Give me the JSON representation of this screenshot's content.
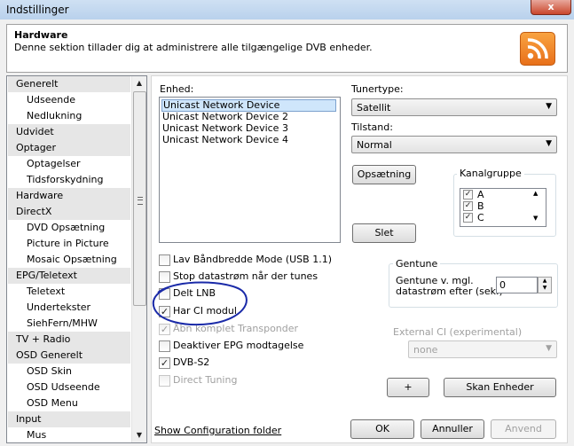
{
  "window": {
    "title": "Indstillinger",
    "close_label": "x"
  },
  "header": {
    "title": "Hardware",
    "description": "Denne sektion tillader dig at administrere alle tilgængelige DVB enheder."
  },
  "sidebar": {
    "items": [
      {
        "label": "Generelt",
        "level": 0
      },
      {
        "label": "Udseende",
        "level": 1
      },
      {
        "label": "Nedlukning",
        "level": 1
      },
      {
        "label": "Udvidet",
        "level": 0
      },
      {
        "label": "Optager",
        "level": 0
      },
      {
        "label": "Optagelser",
        "level": 1
      },
      {
        "label": "Tidsforskydning",
        "level": 1
      },
      {
        "label": "Hardware",
        "level": 0
      },
      {
        "label": "DirectX",
        "level": 0
      },
      {
        "label": "DVD Opsætning",
        "level": 1
      },
      {
        "label": "Picture in Picture",
        "level": 1
      },
      {
        "label": "Mosaic Opsætning",
        "level": 1
      },
      {
        "label": "EPG/Teletext",
        "level": 0
      },
      {
        "label": "Teletext",
        "level": 1
      },
      {
        "label": "Undertekster",
        "level": 1
      },
      {
        "label": "SiehFern/MHW",
        "level": 1
      },
      {
        "label": "TV + Radio",
        "level": 0
      },
      {
        "label": "OSD Generelt",
        "level": 0
      },
      {
        "label": "OSD Skin",
        "level": 1
      },
      {
        "label": "OSD Udseende",
        "level": 1
      },
      {
        "label": "OSD Menu",
        "level": 1
      },
      {
        "label": "Input",
        "level": 0
      },
      {
        "label": "Mus",
        "level": 1
      }
    ]
  },
  "device": {
    "label": "Enhed:",
    "items": [
      "Unicast Network Device",
      "Unicast Network Device 2",
      "Unicast Network Device 3",
      "Unicast Network Device 4"
    ],
    "selected_index": 0
  },
  "tuner": {
    "label": "Tunertype:",
    "value": "Satellit"
  },
  "state": {
    "label": "Tilstand:",
    "value": "Normal"
  },
  "buttons": {
    "setup": "Opsætning",
    "delete": "Slet",
    "plus": "+",
    "scan": "Skan Enheder",
    "ok": "OK",
    "cancel": "Annuller",
    "apply": "Anvend"
  },
  "channel_group": {
    "title": "Kanalgruppe",
    "items": [
      {
        "label": "A",
        "checked": true
      },
      {
        "label": "B",
        "checked": true
      },
      {
        "label": "C",
        "checked": true
      }
    ]
  },
  "options": [
    {
      "label": "Lav Båndbredde Mode (USB 1.1)",
      "checked": false,
      "enabled": true
    },
    {
      "label": "Stop datastrøm når der tunes",
      "checked": false,
      "enabled": true
    },
    {
      "label": "Delt LNB",
      "checked": false,
      "enabled": true
    },
    {
      "label": "Har CI modul",
      "checked": true,
      "enabled": true
    },
    {
      "label": "Åbn komplet Transponder",
      "checked": true,
      "enabled": false
    },
    {
      "label": "Deaktiver EPG modtagelse",
      "checked": false,
      "enabled": true
    },
    {
      "label": "DVB-S2",
      "checked": true,
      "enabled": true
    },
    {
      "label": "Direct Tuning",
      "checked": false,
      "enabled": false
    }
  ],
  "retune": {
    "title": "Gentune",
    "label_line1": "Gentune v. mgl.",
    "label_line2": "datastrøm efter (sek.)",
    "value": "0"
  },
  "external_ci": {
    "label": "External CI (experimental)",
    "value": "none"
  },
  "config_link": "Show Configuration folder",
  "colors": {
    "annotation_circle": "#1a2aa8",
    "selection": "#cfe6fb",
    "rss": "#f08a2a"
  }
}
